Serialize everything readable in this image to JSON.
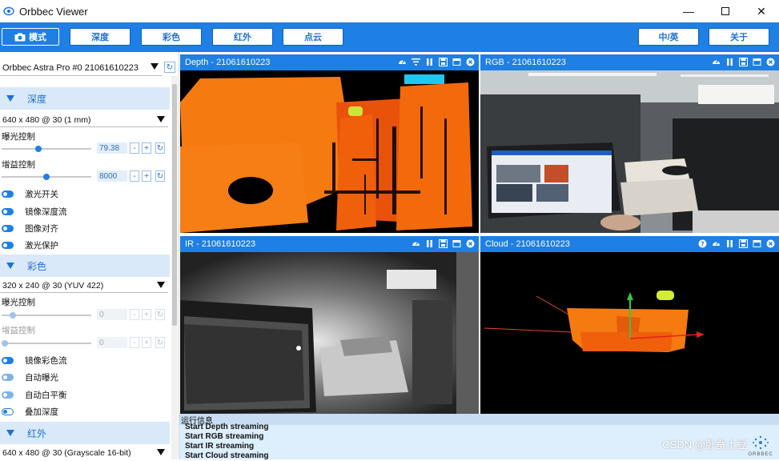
{
  "app": {
    "title": "Orbbec Viewer"
  },
  "toolbar": {
    "mode_label": "模式",
    "tabs": [
      "深度",
      "彩色",
      "红外",
      "点云"
    ],
    "lang_label": "中/英",
    "about_label": "关于"
  },
  "sidebar": {
    "device": "Orbbec Astra Pro #0 21061610223",
    "depth": {
      "header": "深度",
      "resolution": "640 x 480 @ 30 (1 mm)",
      "exposure_label": "曝光控制",
      "exposure_value": "79.38",
      "exposure_level": 0.4,
      "gain_label": "增益控制",
      "gain_value": "8000",
      "gain_level": 0.5,
      "toggles": [
        {
          "label": "激光开关",
          "on": true
        },
        {
          "label": "镜像深度流",
          "on": true
        },
        {
          "label": "图像对齐",
          "on": true
        },
        {
          "label": "激光保护",
          "on": true
        }
      ]
    },
    "color": {
      "header": "彩色",
      "resolution": "320 x 240 @ 30 (YUV 422)",
      "exposure_label": "曝光控制",
      "exposure_value": "0",
      "gain_label": "增益控制",
      "gain_value": "0",
      "toggles": [
        {
          "label": "镜像彩色流",
          "on": true
        },
        {
          "label": "自动曝光",
          "on": true
        },
        {
          "label": "自动白平衡",
          "on": true
        },
        {
          "label": "叠加深度",
          "on": false
        }
      ]
    },
    "ir": {
      "header": "红外",
      "resolution": "640 x 480 @ 30 (Grayscale 16-bit)"
    }
  },
  "panels": {
    "depth_title": "Depth - 21061610223",
    "rgb_title": "RGB - 21061610223",
    "ir_title": "IR - 21061610223",
    "cloud_title": "Cloud - 21061610223"
  },
  "log": {
    "header": "运行信息",
    "lines": [
      "Start Depth streaming",
      "Start RGB streaming",
      "Start IR streaming",
      "Start Cloud streaming"
    ]
  },
  "watermark": "CSDN @卧蚕土豆",
  "brand_label": "ORBBEC",
  "colors": {
    "accent": "#1e7fe4",
    "section_bg": "#d9e9f9",
    "depth_orange": "#f57a10"
  }
}
